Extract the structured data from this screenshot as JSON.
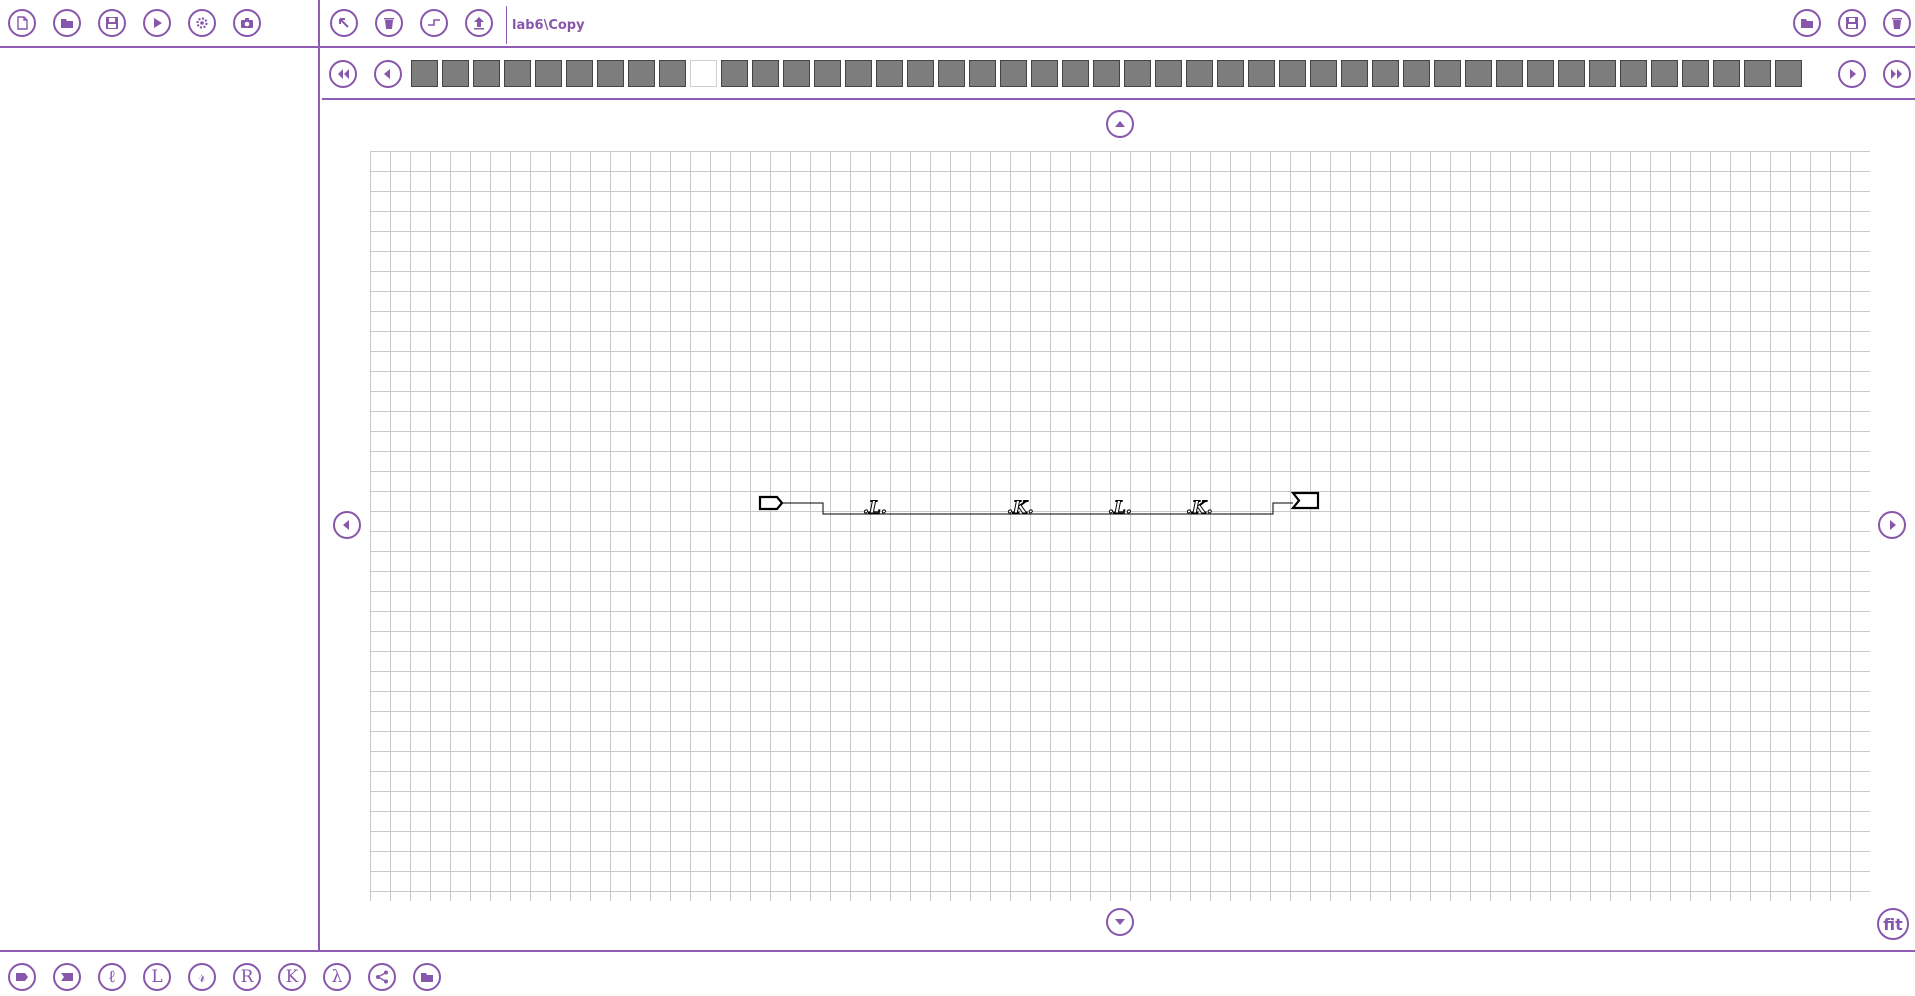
{
  "window": {
    "path_title": "lab6\\Copy"
  },
  "toolbar_left": [
    {
      "name": "new-file-icon",
      "label": "New"
    },
    {
      "name": "open-folder-icon",
      "label": "Open"
    },
    {
      "name": "save-icon",
      "label": "Save"
    },
    {
      "name": "play-icon",
      "label": "Run"
    },
    {
      "name": "gear-icon",
      "label": "Settings"
    },
    {
      "name": "camera-icon",
      "label": "Snapshot"
    }
  ],
  "toolbar_middle": [
    {
      "name": "select-arrow-icon",
      "label": "Select"
    },
    {
      "name": "trash-icon",
      "label": "Delete"
    },
    {
      "name": "step-icon",
      "label": "Step"
    },
    {
      "name": "upload-icon",
      "label": "Up"
    }
  ],
  "toolbar_right": [
    {
      "name": "open-folder-icon",
      "label": "Open"
    },
    {
      "name": "save-icon",
      "label": "Save"
    },
    {
      "name": "trash-icon",
      "label": "Delete"
    }
  ],
  "strip": {
    "slot_count": 45,
    "active_index": 9
  },
  "diagram": {
    "labels": [
      ".L.",
      ".K.",
      ".L.",
      ".K."
    ]
  },
  "canvas_controls": {
    "fit_label": "fit"
  },
  "palette": [
    {
      "name": "input-tag-icon",
      "glyph": ""
    },
    {
      "name": "output-tag-icon",
      "glyph": ""
    },
    {
      "name": "l-script-icon",
      "glyph": "ℓ"
    },
    {
      "name": "l-icon",
      "glyph": "L"
    },
    {
      "name": "r-script-icon",
      "glyph": "𝓇"
    },
    {
      "name": "r-icon",
      "glyph": "R"
    },
    {
      "name": "k-icon",
      "glyph": "K"
    },
    {
      "name": "lambda-icon",
      "glyph": "λ"
    },
    {
      "name": "share-icon",
      "glyph": ""
    },
    {
      "name": "folder-icon",
      "glyph": ""
    }
  ],
  "colors": {
    "accent": "#8757ab",
    "grid": "#c8c8c8",
    "slot": "#7d7d7d"
  }
}
